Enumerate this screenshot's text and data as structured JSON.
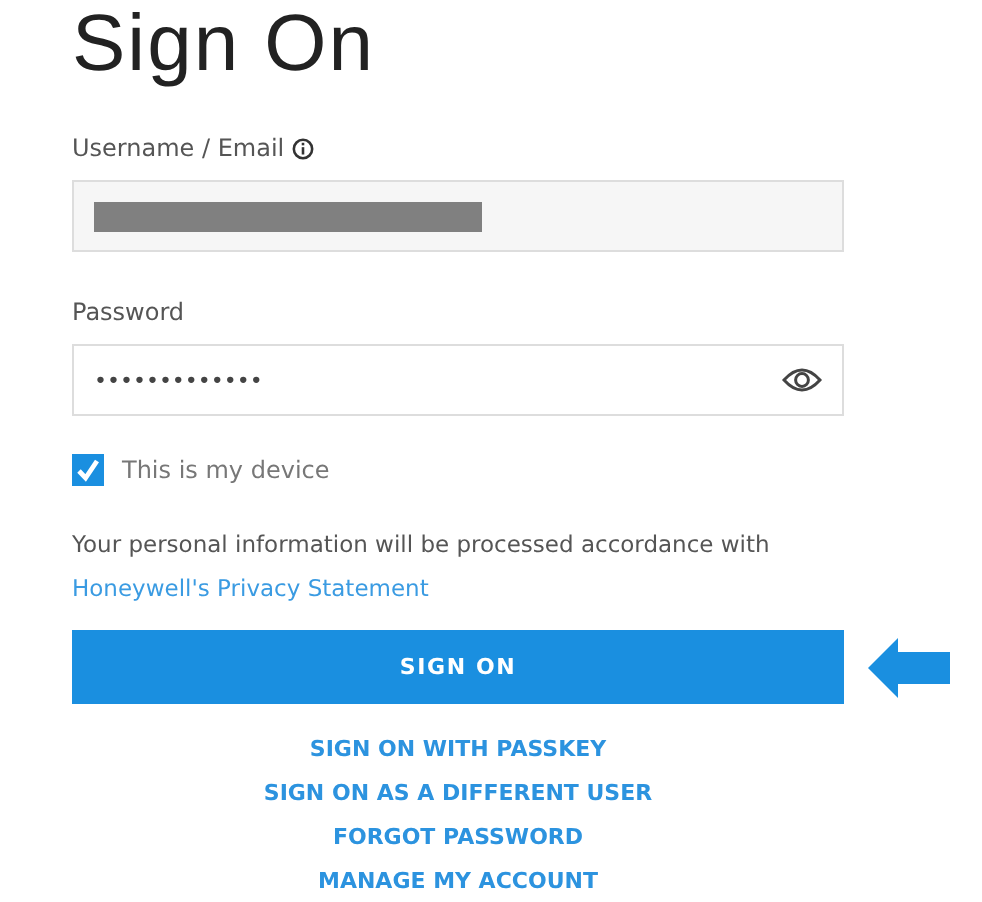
{
  "title": "Sign On",
  "username": {
    "label": "Username / Email",
    "info_icon": true,
    "redacted": true
  },
  "password": {
    "label": "Password",
    "value": "•••••••••••••"
  },
  "device": {
    "label": "This is my device",
    "checked": true
  },
  "notice": {
    "text": "Your personal information will be processed accordance with",
    "link": "Honeywell's Privacy Statement"
  },
  "primary_button": {
    "label": "SIGN ON",
    "pointer_arrow": true
  },
  "links": [
    "SIGN ON WITH PASSKEY",
    "SIGN ON AS A DIFFERENT USER",
    "FORGOT PASSWORD",
    "MANAGE MY ACCOUNT"
  ]
}
